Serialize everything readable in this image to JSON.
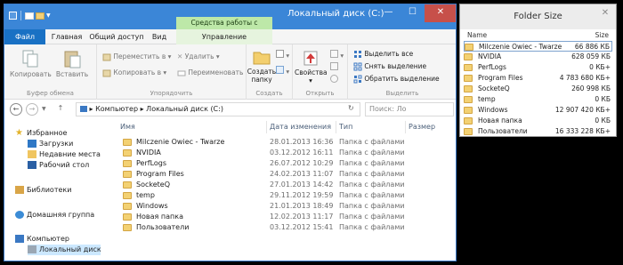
{
  "explorer": {
    "tools_band": "Средства работы с дисками",
    "title": "Локальный диск (C:)",
    "controls": {
      "minimize": "—",
      "maximize": "☐",
      "close": "✕"
    },
    "tabs": [
      "Файл",
      "Главная",
      "Общий доступ",
      "Вид",
      "Управление"
    ],
    "ribbon": {
      "clipboard": {
        "copy": "Копировать",
        "paste": "Вставить",
        "label": "Буфер обмена"
      },
      "organize": {
        "move": "Переместить в",
        "copy_to": "Копировать в",
        "delete": "Удалить",
        "rename": "Переименовать",
        "label": "Упорядочить"
      },
      "create": {
        "new_folder_l1": "Создать",
        "new_folder_l2": "папку",
        "label": "Создать"
      },
      "open": {
        "properties": "Свойства",
        "label": "Открыть"
      },
      "select": {
        "select_all": "Выделить все",
        "select_none": "Снять выделение",
        "invert": "Обратить выделение",
        "label": "Выделить"
      }
    },
    "address": {
      "computer": "Компьютер",
      "drive": "Локальный диск (C:)",
      "search_placeholder": "Поиск: Ло"
    },
    "nav": [
      {
        "label": "Избранное",
        "icon": "star-icon"
      },
      {
        "label": "Загрузки",
        "icon": "downloads-icon"
      },
      {
        "label": "Недавние места",
        "icon": "recent-places-icon"
      },
      {
        "label": "Рабочий стол",
        "icon": "desktop-icon"
      },
      {
        "label": "Библиотеки",
        "icon": "libraries-icon"
      },
      {
        "label": "Домашняя группа",
        "icon": "homegroup-icon"
      },
      {
        "label": "Компьютер",
        "icon": "computer-icon"
      },
      {
        "label": "Локальный диск (C:)",
        "icon": "drive-icon"
      }
    ],
    "columns": {
      "name": "Имя",
      "date": "Дата изменения",
      "type": "Тип",
      "size": "Размер"
    },
    "files": [
      {
        "name": "Milczenie Owiec - Twarze",
        "date": "28.01.2013 16:36",
        "type": "Папка с файлами"
      },
      {
        "name": "NVIDIA",
        "date": "03.12.2012 16:11",
        "type": "Папка с файлами"
      },
      {
        "name": "PerfLogs",
        "date": "26.07.2012 10:29",
        "type": "Папка с файлами"
      },
      {
        "name": "Program Files",
        "date": "24.02.2013 11:07",
        "type": "Папка с файлами"
      },
      {
        "name": "SocketeQ",
        "date": "27.01.2013 14:42",
        "type": "Папка с файлами"
      },
      {
        "name": "temp",
        "date": "29.11.2012 19:59",
        "type": "Папка с файлами"
      },
      {
        "name": "Windows",
        "date": "21.01.2013 18:49",
        "type": "Папка с файлами"
      },
      {
        "name": "Новая папка",
        "date": "12.02.2013 11:17",
        "type": "Папка с файлами"
      },
      {
        "name": "Пользователи",
        "date": "03.12.2012 15:41",
        "type": "Папка с файлами"
      }
    ]
  },
  "folder_size": {
    "title": "Folder Size",
    "close": "✕",
    "columns": {
      "name": "Name",
      "size": "Size"
    },
    "rows": [
      {
        "name": "Milczenie Owiec - Twarze",
        "size": "66 886 КБ"
      },
      {
        "name": "NVIDIA",
        "size": "628 059 КБ"
      },
      {
        "name": "PerfLogs",
        "size": "0 КБ+"
      },
      {
        "name": "Program Files",
        "size": "4 783 680 КБ+"
      },
      {
        "name": "SocketeQ",
        "size": "260 998 КБ"
      },
      {
        "name": "temp",
        "size": "0 КБ"
      },
      {
        "name": "Windows",
        "size": "12 907 420 КБ+"
      },
      {
        "name": "Новая папка",
        "size": "0 КБ"
      },
      {
        "name": "Пользователи",
        "size": "16 333 228 КБ+"
      }
    ]
  }
}
